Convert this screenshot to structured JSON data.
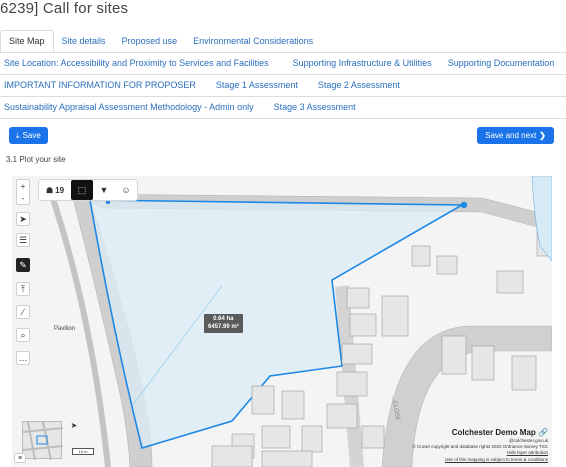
{
  "header": {
    "title": "6239] Call for sites"
  },
  "tabs_row1": [
    {
      "label": "Site Map",
      "active": true
    },
    {
      "label": "Site details",
      "active": false
    },
    {
      "label": "Proposed use",
      "active": false
    },
    {
      "label": "Environmental Considerations",
      "active": false
    }
  ],
  "tabs_row2": [
    {
      "label": "Site Location: Accessibility and Proximity to Services and Facilities"
    },
    {
      "label": "Supporting Infrastructure & Utilities"
    },
    {
      "label": "Supporting Documentation"
    }
  ],
  "tabs_row3": [
    {
      "label": "IMPORTANT INFORMATION FOR PROPOSER"
    },
    {
      "label": "Stage 1 Assessment"
    },
    {
      "label": "Stage 2 Assessment"
    }
  ],
  "tabs_row4": [
    {
      "label": "Sustainability Appraisal Assessment Methodology - Admin only"
    },
    {
      "label": "Stage 3 Assessment"
    }
  ],
  "actions": {
    "save_label": "Save",
    "save_next_label": "Save and next"
  },
  "section": {
    "label": "3.1 Plot your site"
  },
  "map": {
    "zoom_in": "+",
    "zoom_out": "-",
    "feature_count": "19",
    "area_ha": "0.64 ha",
    "area_m2": "6457.99 m²",
    "pavilion_label": "Pavilion",
    "title": "Colchester Demo Map",
    "email": "@colchester.gov.uk",
    "copyright": "© Crown copyright and database rights 2020 Ordnance Survey TSC",
    "hide_link": "Hide layer attribution",
    "terms_link": "Use of this mapping is subject to terms & conditions",
    "scale_label": "10 m",
    "road_label": "...CLOSE",
    "colors": {
      "boundary": "#1e88e5",
      "fill": "#dcecf7",
      "road": "#c9c9c9"
    }
  },
  "icons": {
    "binoculars": "binoculars-icon",
    "polygon": "polygon-icon",
    "marker": "marker-icon",
    "palette": "palette-icon"
  }
}
